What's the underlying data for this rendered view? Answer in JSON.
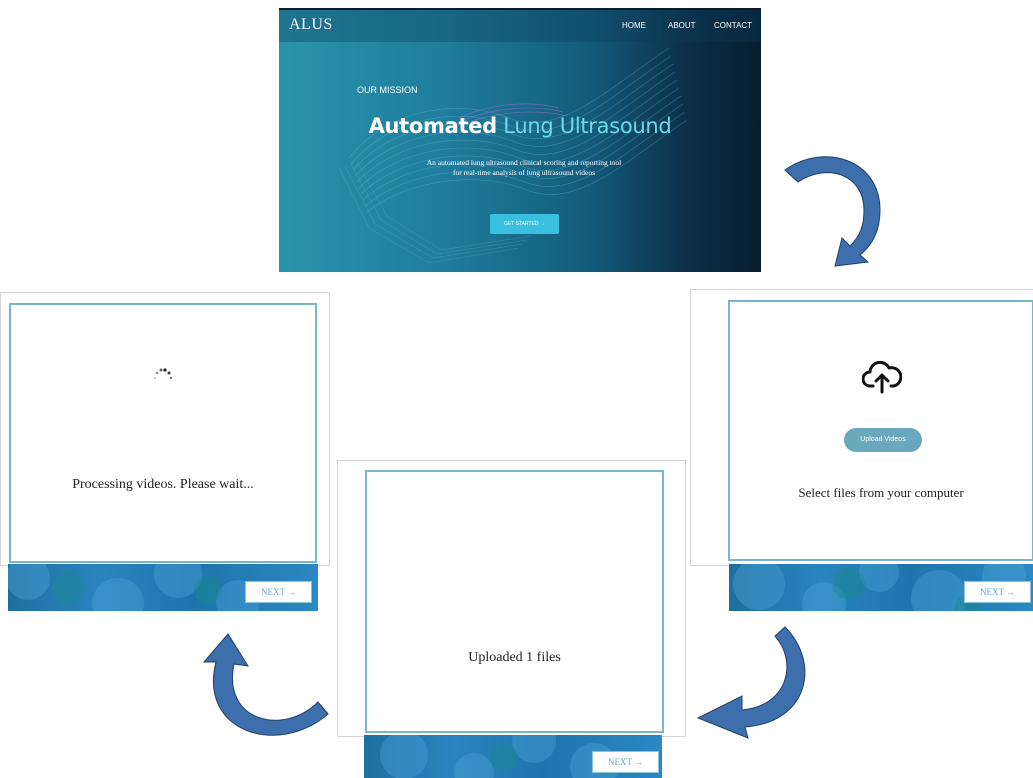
{
  "hero": {
    "brand": "ALUS",
    "nav": [
      "HOME",
      "ABOUT",
      "CONTACT"
    ],
    "eyebrow": "OUR MISSION",
    "headline_bold": "Automated",
    "headline_accent": "Lung Ultrasound",
    "description_line1": "An automated lung ultrasound clinical scoring and reporting tool",
    "description_line2": "for real-time analysis of lung ultrasound videos",
    "cta_label": "GET STARTED →"
  },
  "upload_screen": {
    "icon": "cloud-upload-icon",
    "button_label": "Upload Videos",
    "message": "Select files from your computer",
    "next_label": "NEXT →"
  },
  "uploaded_screen": {
    "message": "Uploaded 1 files",
    "next_label": "NEXT →"
  },
  "processing_screen": {
    "icon": "spinner-icon",
    "message": "Processing videos. Please wait...",
    "next_label": "NEXT →"
  },
  "colors": {
    "card_border": "#7ab6cb",
    "arrow": "#3d6fad",
    "accent": "#6fd8ea",
    "button": "#6aa9bd"
  }
}
